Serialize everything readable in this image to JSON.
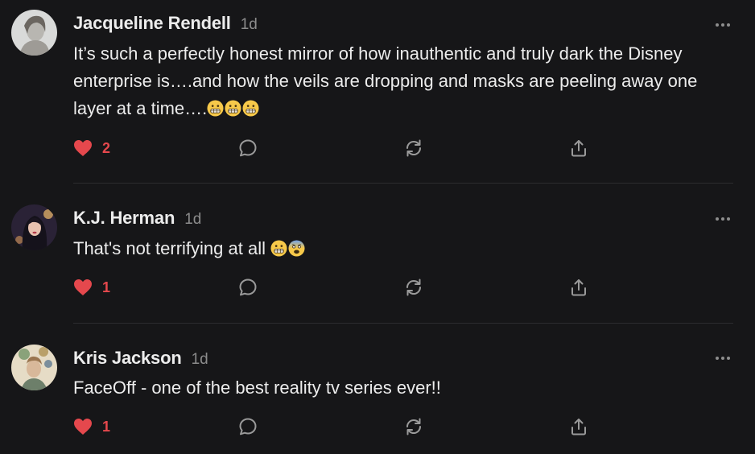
{
  "comments": [
    {
      "author": "Jacqueline Rendell",
      "time": "1d",
      "text": "It’s such a perfectly honest mirror of how inauthentic and truly dark the Disney enterprise is….and how the veils are dropping and masks are peeling away one layer at a time….",
      "emojis": [
        "grimacing",
        "grimacing",
        "grimacing"
      ],
      "likes": "2",
      "liked": true
    },
    {
      "author": "K.J. Herman",
      "time": "1d",
      "text": "That's not terrifying at all ",
      "emojis": [
        "grimacing",
        "fearful"
      ],
      "likes": "1",
      "liked": true
    },
    {
      "author": "Kris Jackson",
      "time": "1d",
      "text": "FaceOff - one of the best reality tv series ever!!",
      "emojis": [],
      "likes": "1",
      "liked": true
    }
  ],
  "icons": {
    "like": "heart-icon",
    "reply": "comment-bubble-icon",
    "restack": "restack-icon",
    "share": "share-icon",
    "menu": "more-options-icon"
  },
  "colors": {
    "background": "#161618",
    "like": "#e5484d",
    "icon": "#9a9a9a",
    "divider": "#2c2c2f"
  }
}
